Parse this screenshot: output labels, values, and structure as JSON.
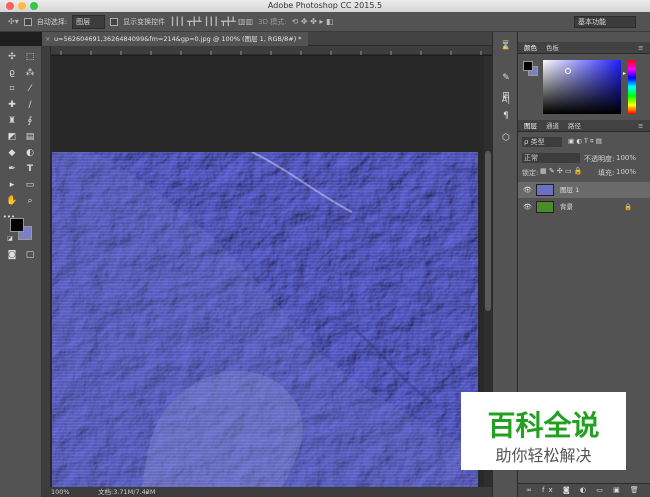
{
  "app": {
    "title": "Adobe Photoshop CC 2015.5"
  },
  "options_bar": {
    "auto_select_label": "自动选择:",
    "auto_select_value": "图层",
    "transform_controls_label": "显示变换控件",
    "mode_3d_label": "3D 模式:",
    "workspace": "基本功能"
  },
  "document": {
    "tab_title": "u=562604691,3626484099&fm=214&gp=0.jpg @ 100% (图层 1, RGB/8#) *",
    "zoom": "100%",
    "doc_size": "文档:3.71M/7.42M"
  },
  "color_panel": {
    "tabs": [
      "颜色",
      "色板"
    ],
    "fg_color": "#000000",
    "bg_color": "#7b7fc4"
  },
  "layers_panel": {
    "tabs": [
      "图层",
      "通道",
      "路径"
    ],
    "kind_filter": "ρ 类型",
    "blend_mode": "正常",
    "opacity_label": "不透明度:",
    "opacity_value": "100%",
    "lock_label": "锁定:",
    "fill_label": "填充:",
    "fill_value": "100%",
    "layers": [
      {
        "name": "图层 1",
        "selected": true
      },
      {
        "name": "背景",
        "selected": false,
        "locked": true
      }
    ]
  },
  "watermark": {
    "title": "百科全说",
    "subtitle": "助你轻松解决"
  },
  "icons": [
    "move-icon",
    "marquee-icon",
    "lasso-icon",
    "magic-wand-icon",
    "crop-icon",
    "eyedropper-icon",
    "healing-icon",
    "brush-icon",
    "stamp-icon",
    "history-brush-icon",
    "eraser-icon",
    "gradient-icon",
    "blur-icon",
    "dodge-icon",
    "pen-icon",
    "type-icon",
    "path-select-icon",
    "shape-icon",
    "hand-icon",
    "zoom-icon",
    "eye-icon",
    "lock-icon"
  ],
  "colors": {
    "accent": "#6b6fc0",
    "panel": "#535353",
    "canvas_bg": "#282828"
  }
}
